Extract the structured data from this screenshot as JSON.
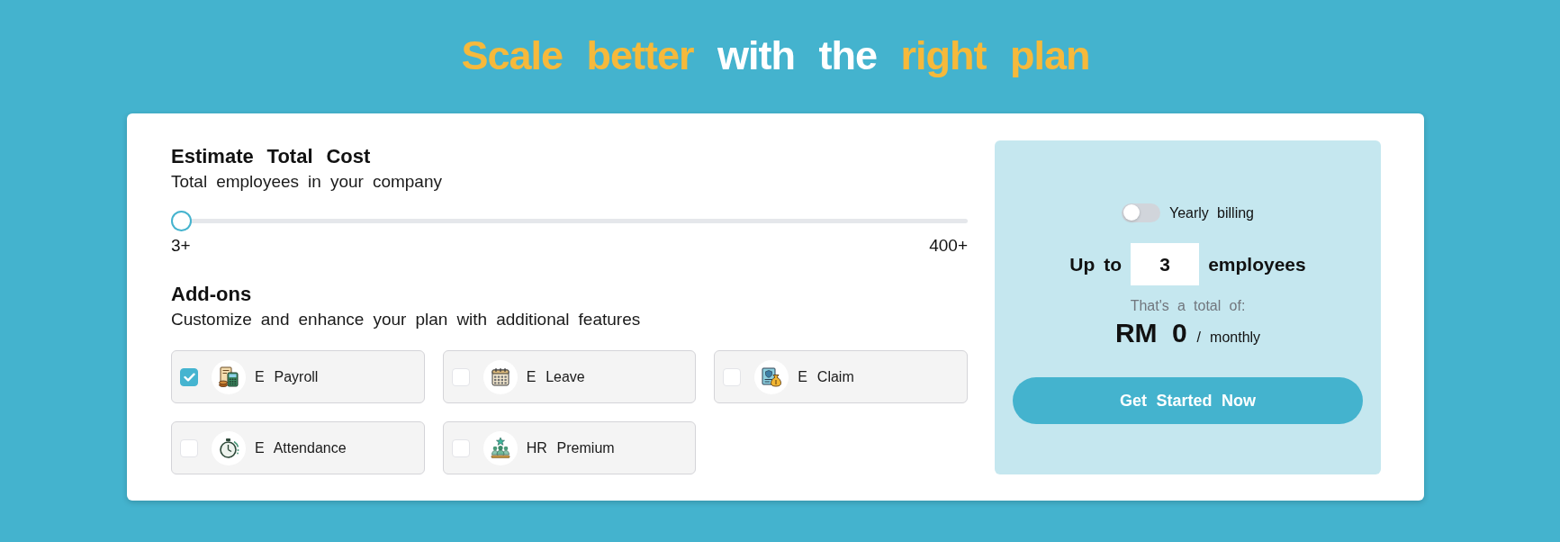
{
  "title": {
    "segments": [
      {
        "text": "Scale better",
        "highlighted": true
      },
      {
        "text": "with the",
        "highlighted": false
      },
      {
        "text": "right plan",
        "highlighted": true
      }
    ]
  },
  "estimate": {
    "heading": "Estimate Total Cost",
    "subheading": "Total employees in your company",
    "slider": {
      "level": 0,
      "min_label": "3+",
      "max_label": "400+"
    }
  },
  "addons": {
    "heading": "Add-ons",
    "subheading": "Customize and enhance your plan with additional features",
    "items": [
      {
        "label": "E Payroll",
        "checked": true
      },
      {
        "label": "E Leave",
        "checked": false
      },
      {
        "label": "E Claim",
        "checked": false
      },
      {
        "label": "E Attendance",
        "checked": false
      },
      {
        "label": "HR Premium",
        "checked": false
      }
    ]
  },
  "summary": {
    "billing_toggle": {
      "label": "Yearly billing",
      "on": false
    },
    "seats": {
      "prefix": "Up to",
      "value": "3",
      "suffix": "employees"
    },
    "total_caption": "That's a total of:",
    "price": {
      "amount": "RM 0",
      "period": "/ monthly"
    },
    "cta": "Get Started Now"
  }
}
